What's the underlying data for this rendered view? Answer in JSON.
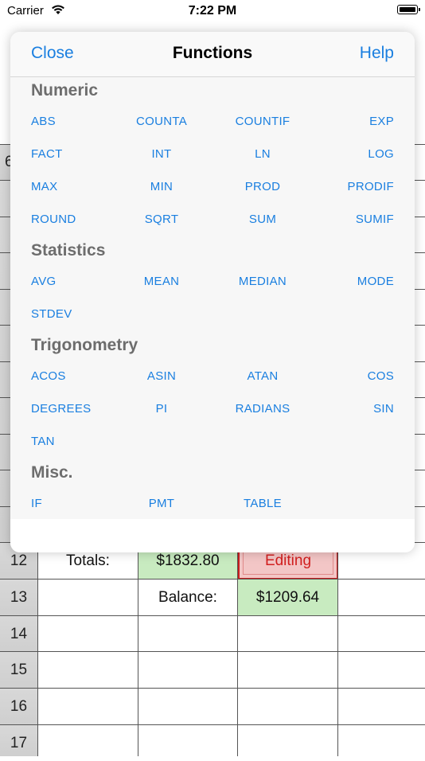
{
  "status_bar": {
    "carrier": "Carrier",
    "time": "7:22 PM"
  },
  "sheet": {
    "rows": [
      {
        "num": "12",
        "cells": [
          "Totals:",
          "$1832.80",
          "Editing",
          ""
        ]
      },
      {
        "num": "13",
        "cells": [
          "",
          "Balance:",
          "$1209.64",
          ""
        ]
      },
      {
        "num": "14",
        "cells": [
          "",
          "",
          "",
          ""
        ]
      },
      {
        "num": "15",
        "cells": [
          "",
          "",
          "",
          ""
        ]
      },
      {
        "num": "16",
        "cells": [
          "",
          "",
          "",
          ""
        ]
      },
      {
        "num": "17",
        "cells": [
          "",
          "",
          "",
          ""
        ]
      }
    ],
    "partial_cell_text": "6",
    "colors": {
      "green": "#c8ebc0",
      "editing_bg": "#f3c6c6",
      "editing_border": "#c81e1e",
      "row_header": "#d3d3d3"
    }
  },
  "popover": {
    "close_label": "Close",
    "title": "Functions",
    "help_label": "Help",
    "accent": "#1a7fe0",
    "sections": [
      {
        "title": "Numeric",
        "functions": [
          "ABS",
          "COUNTA",
          "COUNTIF",
          "EXP",
          "FACT",
          "INT",
          "LN",
          "LOG",
          "MAX",
          "MIN",
          "PROD",
          "PRODIF",
          "ROUND",
          "SQRT",
          "SUM",
          "SUMIF"
        ]
      },
      {
        "title": "Statistics",
        "functions": [
          "AVG",
          "MEAN",
          "MEDIAN",
          "MODE",
          "STDEV"
        ]
      },
      {
        "title": "Trigonometry",
        "functions": [
          "ACOS",
          "ASIN",
          "ATAN",
          "COS",
          "DEGREES",
          "PI",
          "RADIANS",
          "SIN",
          "TAN"
        ]
      },
      {
        "title": "Misc.",
        "functions": [
          "IF",
          "PMT",
          "TABLE"
        ]
      }
    ]
  }
}
